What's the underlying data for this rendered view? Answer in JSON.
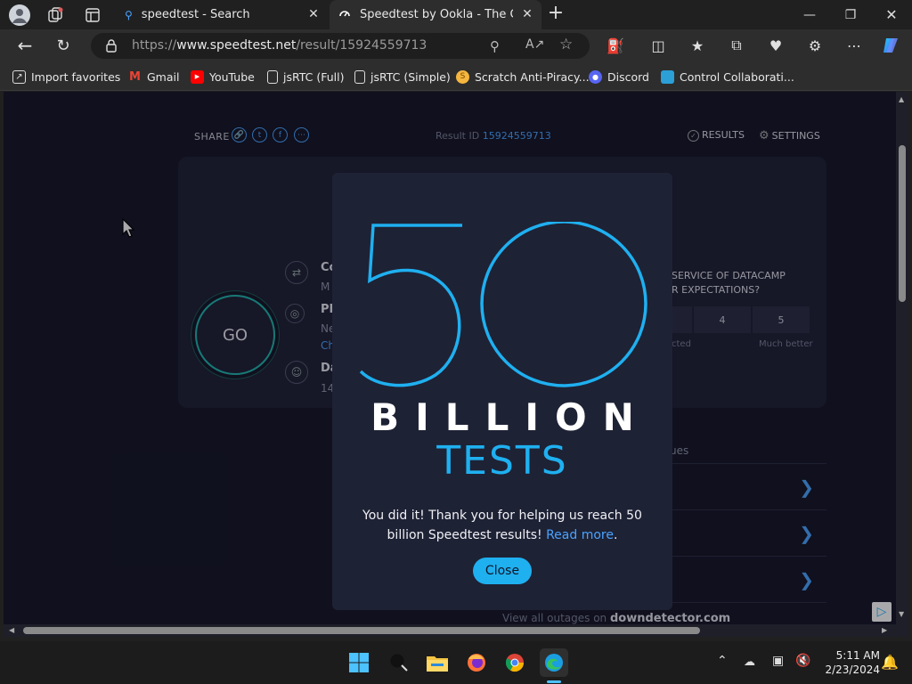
{
  "tabs": [
    {
      "title": "speedtest - Search",
      "active": false
    },
    {
      "title": "Speedtest by Ookla - The Global",
      "active": true
    }
  ],
  "address": {
    "url_prefix": "https://",
    "url_host": "www.speedtest.net",
    "url_path": "/result/15924559713"
  },
  "favorites": [
    {
      "label": "Import favorites",
      "icon": "import-icon"
    },
    {
      "label": "Gmail",
      "icon": "gmail-icon"
    },
    {
      "label": "YouTube",
      "icon": "youtube-icon"
    },
    {
      "label": "jsRTC (Full)",
      "icon": "page-icon"
    },
    {
      "label": "jsRTC (Simple)",
      "icon": "page-icon"
    },
    {
      "label": "Scratch Anti-Piracy...",
      "icon": "scratch-icon"
    },
    {
      "label": "Discord",
      "icon": "discord-icon"
    },
    {
      "label": "Control Collaborati...",
      "icon": "monitor-icon"
    }
  ],
  "page": {
    "share_label": "SHARE",
    "result_id_label": "Result ID",
    "result_id": "15924559713",
    "results_label": "RESULTS",
    "settings_label": "SETTINGS",
    "go_label": "GO",
    "survey_line1": "SERVICE OF DATACAMP",
    "survey_line2": "R EXPECTATIONS?",
    "rating_4": "4",
    "rating_5": "5",
    "rating_low": "cted",
    "rating_high": "Much better",
    "issues_partial": "ues",
    "downdetector_prefix": "View all outages on",
    "downdetector_brand": "downdetector.com",
    "partial_left": {
      "row1": "Co",
      "row2": "M",
      "row3": "PF",
      "row4": "Ne",
      "row5": "Ch",
      "row6": "Da",
      "row7": "14"
    }
  },
  "modal": {
    "headline_number": "50",
    "headline_word": "BILLION",
    "headline_sub": "TESTS",
    "message_part1": "You did it! Thank you for helping us reach 50",
    "message_part2": "billion Speedtest results!",
    "read_more": "Read more",
    "close_label": "Close"
  },
  "taskbar": {
    "time": "5:11 AM",
    "date": "2/23/2024"
  },
  "colors": {
    "accent": "#1fb0f0",
    "link": "#4aa3ff",
    "go_ring": "#1fb6ad",
    "page_bg": "#141526",
    "modal_bg": "#1e2235"
  }
}
